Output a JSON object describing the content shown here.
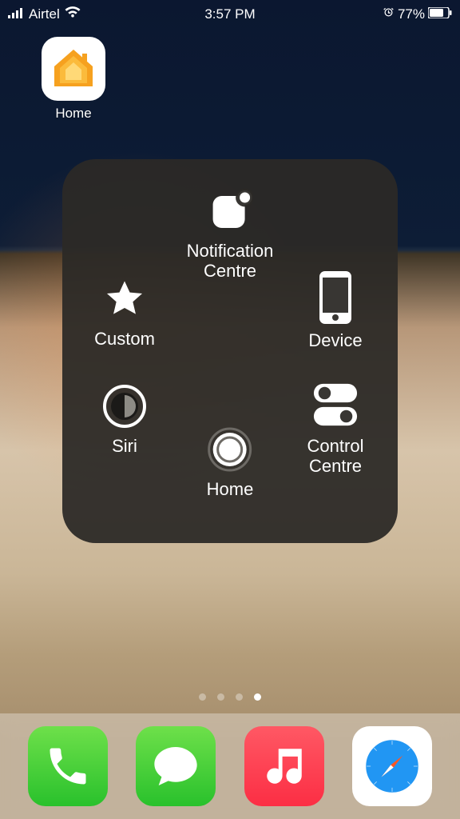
{
  "status": {
    "carrier": "Airtel",
    "time": "3:57 PM",
    "battery_percent": "77%"
  },
  "home_screen": {
    "apps": [
      {
        "label": "Home"
      }
    ]
  },
  "assistive_touch": {
    "items": {
      "top": {
        "label": "Notification\nCentre"
      },
      "left": {
        "label": "Custom"
      },
      "right": {
        "label": "Device"
      },
      "bl": {
        "label": "Siri"
      },
      "br": {
        "label": "Control\nCentre"
      },
      "bottom": {
        "label": "Home"
      }
    }
  },
  "page_dots": {
    "count": 4,
    "active_index": 3
  },
  "dock": {
    "apps": [
      {
        "name": "phone"
      },
      {
        "name": "messages"
      },
      {
        "name": "music"
      },
      {
        "name": "safari"
      }
    ]
  }
}
